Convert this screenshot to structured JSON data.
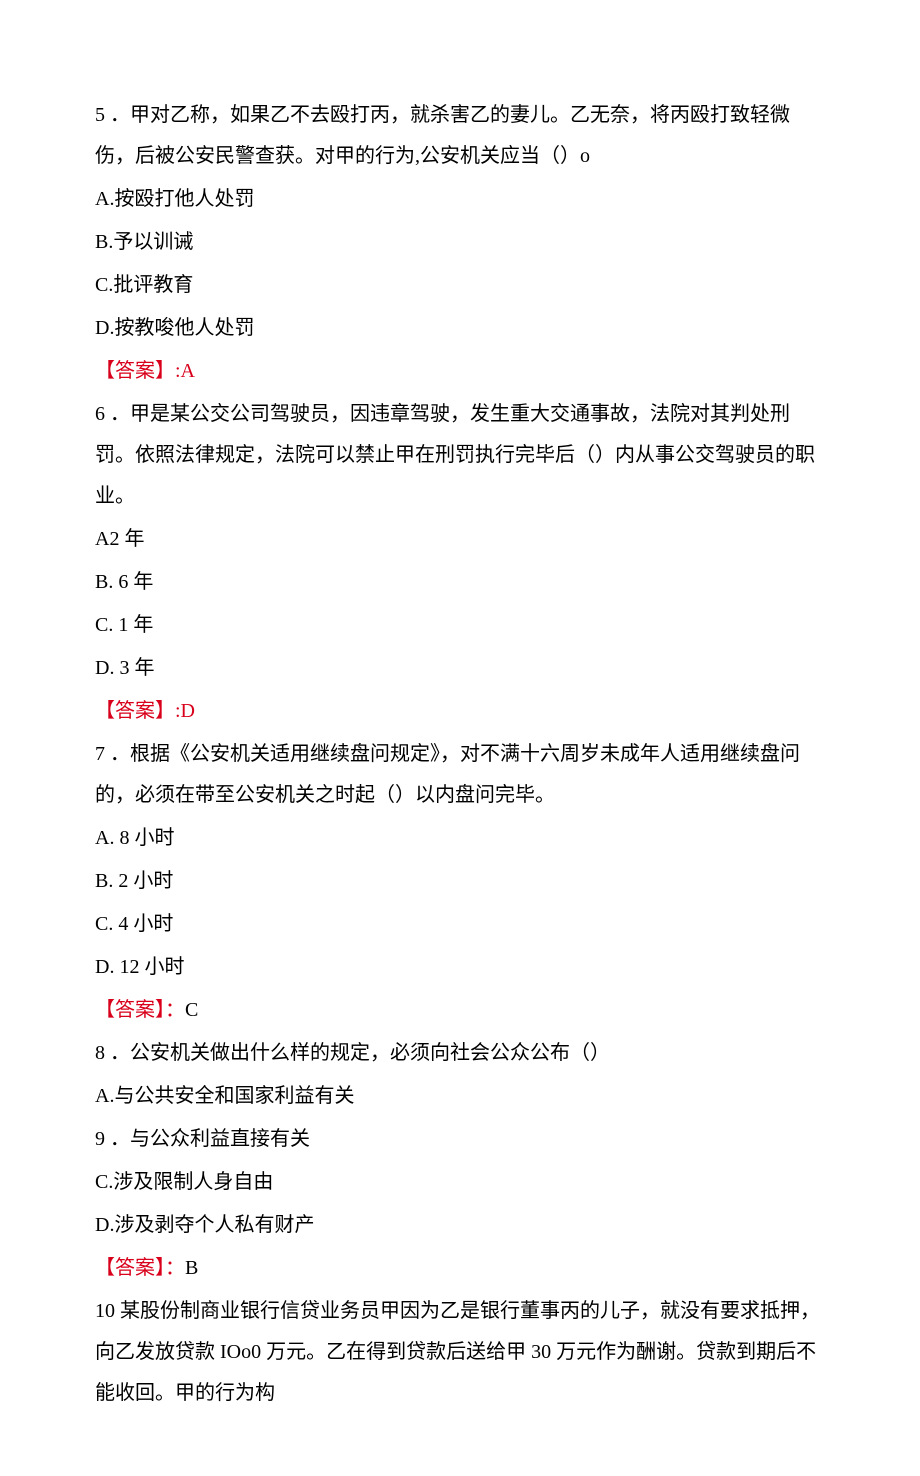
{
  "q5": {
    "stem": "5 ．甲对乙称，如果乙不去殴打丙，就杀害乙的妻儿。乙无奈，将丙殴打致轻微伤，后被公安民警查获。对甲的行为,公安机关应当（）o",
    "A": "A.按殴打他人处罚",
    "B": "B.予以训诫",
    "C": "C.批评教育",
    "D": "D.按教唆他人处罚",
    "ans": "【答案】:A"
  },
  "q6": {
    "stem": "6 ．甲是某公交公司驾驶员，因违章驾驶，发生重大交通事故，法院对其判处刑罚。依照法律规定，法院可以禁止甲在刑罚执行完毕后（）内从事公交驾驶员的职业。",
    "A": "A2 年",
    "B": "B. 6 年",
    "C": "C. 1 年",
    "D": "D. 3 年",
    "ans": "【答案】:D"
  },
  "q7": {
    "stem": "7 ．根据《公安机关适用继续盘问规定》，对不满十六周岁未成年人适用继续盘问的，必须在带至公安机关之时起（）以内盘问完毕。",
    "A": "A. 8 小时",
    "B": "B. 2 小时",
    "C": "C. 4 小时",
    "D": "D. 12 小时",
    "ans_bracket": "【答案】：",
    "ans_letter": "C"
  },
  "q8": {
    "stem": "8 ．公安机关做出什么样的规定，必须向社会公众公布（）",
    "A": "A.与公共安全和国家利益有关",
    "B": "9 ．与公众利益直接有关",
    "C": "C.涉及限制人身自由",
    "D": "D.涉及剥夺个人私有财产",
    "ans_bracket": "【答案】：",
    "ans_letter": "B"
  },
  "q10": {
    "stem": "10 某股份制商业银行信贷业务员甲因为乙是银行董事丙的儿子，就没有要求抵押，向乙发放贷款 IOo0 万元。乙在得到贷款后送给甲 30 万元作为酬谢。贷款到期后不能收回。甲的行为构"
  }
}
